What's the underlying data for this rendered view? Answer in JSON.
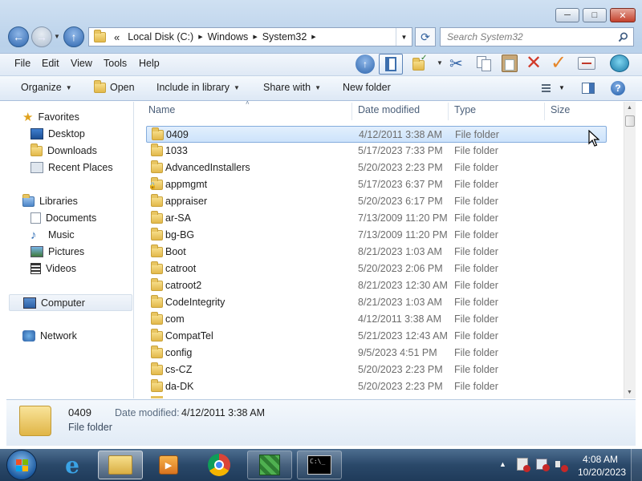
{
  "window": {
    "minimize_glyph": "─",
    "maximize_glyph": "□",
    "close_glyph": "✕"
  },
  "address": {
    "chevron": "«",
    "crumbs": [
      "Local Disk (C:)",
      "Windows",
      "System32"
    ],
    "sep": "▶",
    "refresh_glyph": "⟳"
  },
  "search": {
    "placeholder": "Search System32"
  },
  "menu": {
    "file": "File",
    "edit": "Edit",
    "view": "View",
    "tools": "Tools",
    "help": "Help"
  },
  "command_bar": {
    "organize": "Organize",
    "open": "Open",
    "include_in_library": "Include in library",
    "share_with": "Share with",
    "new_folder": "New folder",
    "help_glyph": "?"
  },
  "nav_pane": {
    "favorites": "Favorites",
    "desktop": "Desktop",
    "downloads": "Downloads",
    "recent_places": "Recent Places",
    "libraries": "Libraries",
    "documents": "Documents",
    "music": "Music",
    "pictures": "Pictures",
    "videos": "Videos",
    "computer": "Computer",
    "network": "Network"
  },
  "columns": {
    "name": "Name",
    "date_modified": "Date modified",
    "type": "Type",
    "size": "Size"
  },
  "files": [
    {
      "name": "0409",
      "date": "4/12/2011 3:38 AM",
      "type": "File folder",
      "selected": true
    },
    {
      "name": "1033",
      "date": "5/17/2023 7:33 PM",
      "type": "File folder"
    },
    {
      "name": "AdvancedInstallers",
      "date": "5/20/2023 2:23 PM",
      "type": "File folder"
    },
    {
      "name": "appmgmt",
      "date": "5/17/2023 6:37 PM",
      "type": "File folder",
      "locked": true
    },
    {
      "name": "appraiser",
      "date": "5/20/2023 6:17 PM",
      "type": "File folder"
    },
    {
      "name": "ar-SA",
      "date": "7/13/2009 11:20 PM",
      "type": "File folder"
    },
    {
      "name": "bg-BG",
      "date": "7/13/2009 11:20 PM",
      "type": "File folder"
    },
    {
      "name": "Boot",
      "date": "8/21/2023 1:03 AM",
      "type": "File folder"
    },
    {
      "name": "catroot",
      "date": "5/20/2023 2:06 PM",
      "type": "File folder"
    },
    {
      "name": "catroot2",
      "date": "8/21/2023 12:30 AM",
      "type": "File folder"
    },
    {
      "name": "CodeIntegrity",
      "date": "8/21/2023 1:03 AM",
      "type": "File folder"
    },
    {
      "name": "com",
      "date": "4/12/2011 3:38 AM",
      "type": "File folder"
    },
    {
      "name": "CompatTel",
      "date": "5/21/2023 12:43 AM",
      "type": "File folder"
    },
    {
      "name": "config",
      "date": "9/5/2023 4:51 PM",
      "type": "File folder"
    },
    {
      "name": "cs-CZ",
      "date": "5/20/2023 2:23 PM",
      "type": "File folder"
    },
    {
      "name": "da-DK",
      "date": "5/20/2023 2:23 PM",
      "type": "File folder"
    }
  ],
  "details": {
    "name": "0409",
    "date_label": "Date modified:",
    "date_value": "4/12/2011 3:38 AM",
    "type": "File folder"
  },
  "taskbar": {
    "time": "4:08 AM",
    "date": "10/20/2023",
    "tray_arrow": "▲"
  },
  "colors": {
    "accent": "#3a73b8",
    "selection": "#cde3fb"
  }
}
